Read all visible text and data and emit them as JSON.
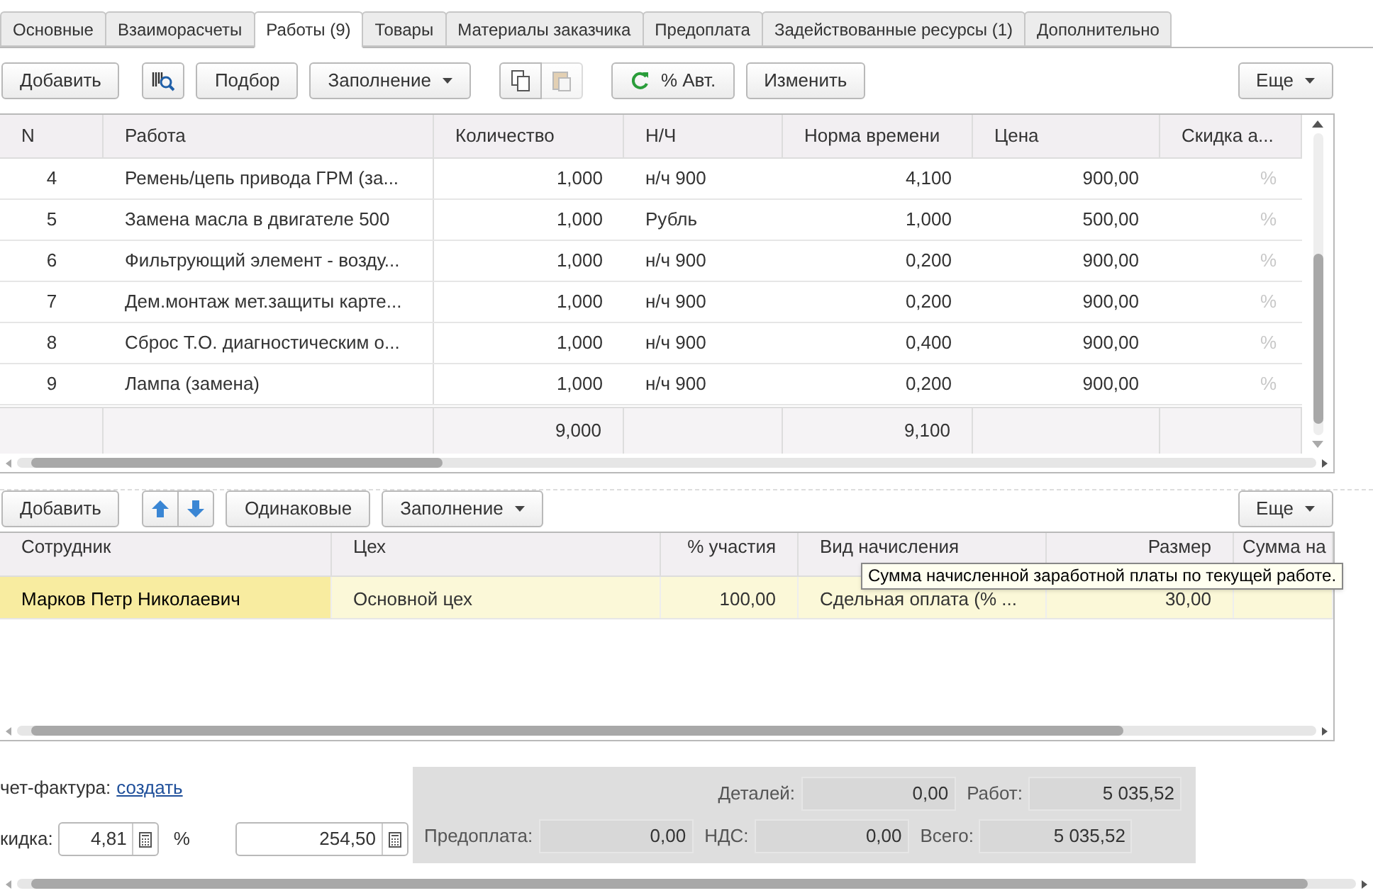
{
  "tabs": [
    {
      "label": "Основные",
      "selected": false
    },
    {
      "label": "Взаиморасчеты",
      "selected": false
    },
    {
      "label": "Работы (9)",
      "selected": true
    },
    {
      "label": "Товары",
      "selected": false
    },
    {
      "label": "Материалы заказчика",
      "selected": false
    },
    {
      "label": "Предоплата",
      "selected": false
    },
    {
      "label": "Задействованные ресурсы (1)",
      "selected": false
    },
    {
      "label": "Дополнительно",
      "selected": false
    }
  ],
  "works_toolbar": [
    {
      "kind": "text",
      "label": "Добавить"
    },
    {
      "kind": "barcode"
    },
    {
      "kind": "text",
      "label": "Подбор"
    },
    {
      "kind": "dropdown",
      "label": "Заполнение"
    },
    {
      "kind": "copy-pair",
      "disabled": true
    },
    {
      "kind": "refresh",
      "label": "% Авт."
    },
    {
      "kind": "text",
      "label": "Изменить"
    },
    {
      "kind": "more",
      "label": "Еще"
    }
  ],
  "works_table": {
    "columns": [
      "N",
      "Работа",
      "Количество",
      "Н/Ч",
      "Норма времени",
      "Цена",
      "Скидка а..."
    ],
    "rows": [
      [
        "4",
        "Ремень/цепь привода ГРМ (за...",
        "1,000",
        "н/ч 900",
        "4,100",
        "900,00",
        "%"
      ],
      [
        "5",
        "Замена масла в двигателе 500",
        "1,000",
        "Рубль",
        "1,000",
        "500,00",
        "%"
      ],
      [
        "6",
        "Фильтрующий элемент - возду...",
        "1,000",
        "н/ч 900",
        "0,200",
        "900,00",
        "%"
      ],
      [
        "7",
        "Дем.монтаж мет.защиты карте...",
        "1,000",
        "н/ч 900",
        "0,200",
        "900,00",
        "%"
      ],
      [
        "8",
        "Сброс Т.О. диагностическим о...",
        "1,000",
        "н/ч 900",
        "0,400",
        "900,00",
        "%"
      ],
      [
        "9",
        "Лампа (замена)",
        "1,000",
        "н/ч 900",
        "0,200",
        "900,00",
        "%"
      ]
    ],
    "totals": {
      "quantity": "9,000",
      "time_norm": "9,100"
    }
  },
  "staff_toolbar": [
    {
      "kind": "text",
      "label": "Добавить"
    },
    {
      "kind": "arrows"
    },
    {
      "kind": "text",
      "label": "Одинаковые"
    },
    {
      "kind": "dropdown",
      "label": "Заполнение"
    },
    {
      "kind": "more",
      "label": "Еще"
    }
  ],
  "staff_table": {
    "columns": [
      "Сотрудник",
      "Цех",
      "% участия",
      "Вид начисления",
      "Размер",
      "Сумма на"
    ],
    "rows": [
      {
        "selected": true,
        "cells": [
          "Марков Петр Николаевич",
          "Основной цех",
          "100,00",
          "Сдельная оплата (% ...",
          "30,00"
        ]
      }
    ]
  },
  "tooltip": "Сумма начисленной заработной платы по текущей работе.",
  "invoice": {
    "label": "чет-фактура:",
    "link": "создать"
  },
  "discount": {
    "label": "кидка:",
    "percent": "4,81",
    "percent_sign": "%",
    "amount": "254,50"
  },
  "totals": [
    {
      "label": "Деталей:",
      "value": "0,00"
    },
    {
      "label": "Работ:",
      "value": "5 035,52"
    },
    {
      "label": "Предоплата:",
      "value": "0,00"
    },
    {
      "label": "НДС:",
      "value": "0,00"
    },
    {
      "label": "Всего:",
      "value": "5 035,52"
    }
  ]
}
